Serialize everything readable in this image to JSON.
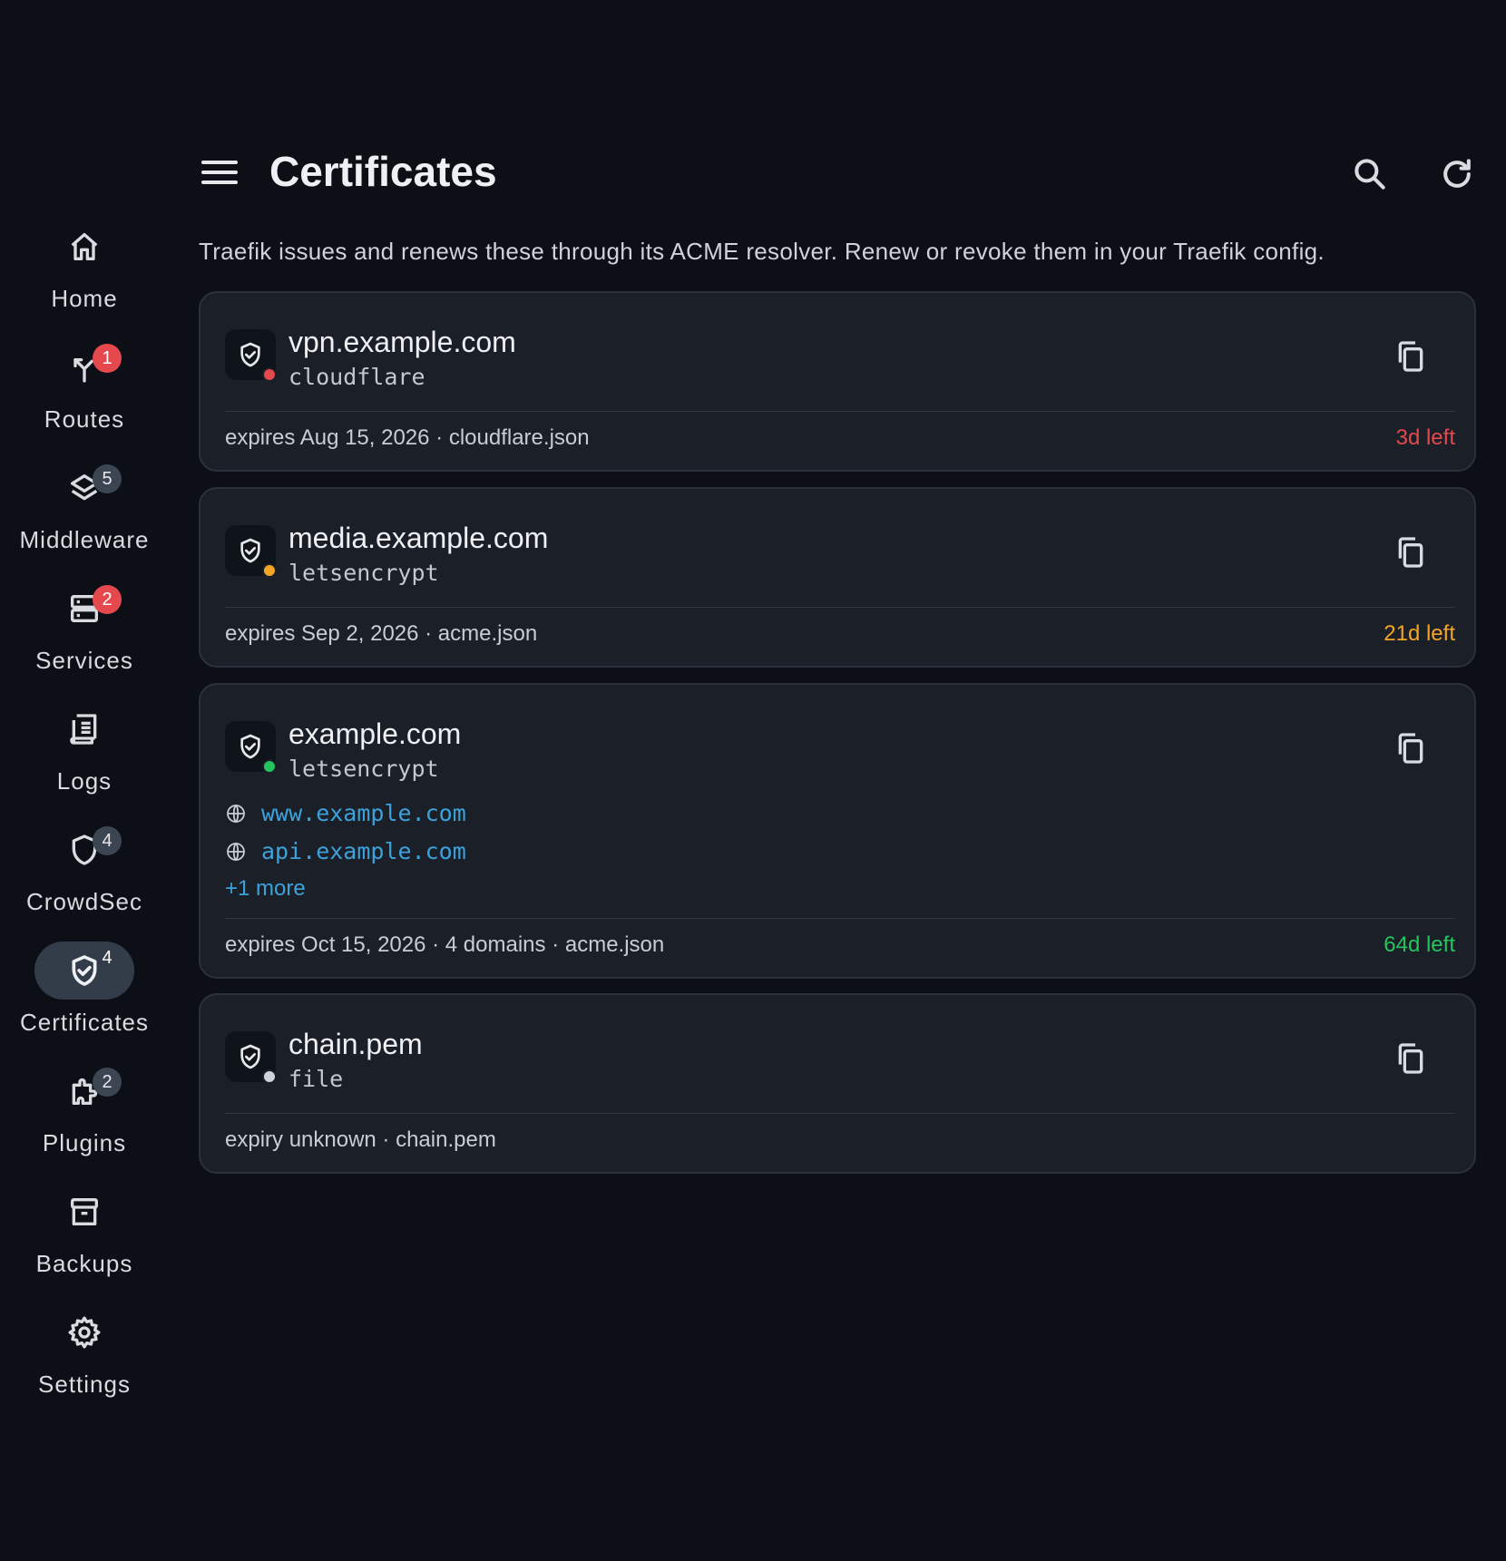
{
  "header": {
    "title": "Certificates",
    "description": "Traefik issues and renews these through its ACME resolver. Renew or revoke them in your Traefik config."
  },
  "sidebar": {
    "items": [
      {
        "label": "Home",
        "icon": "home-icon",
        "badge": ""
      },
      {
        "label": "Routes",
        "icon": "routes-icon",
        "badge": "1"
      },
      {
        "label": "Middleware",
        "icon": "layers-icon",
        "badge": "5"
      },
      {
        "label": "Services",
        "icon": "server-icon",
        "badge": "2"
      },
      {
        "label": "Logs",
        "icon": "logs-icon",
        "badge": ""
      },
      {
        "label": "CrowdSec",
        "icon": "shield-icon",
        "badge": "4"
      },
      {
        "label": "Certificates",
        "icon": "certificate-shield-icon",
        "badge": "4",
        "active": true
      },
      {
        "label": "Plugins",
        "icon": "puzzle-icon",
        "badge": "2"
      },
      {
        "label": "Backups",
        "icon": "archive-icon",
        "badge": ""
      },
      {
        "label": "Settings",
        "icon": "gear-icon",
        "badge": ""
      }
    ]
  },
  "certificates": [
    {
      "name": "vpn.example.com",
      "resolver": "cloudflare",
      "status_color": "#e5484d",
      "footer": "expires Aug 15, 2026 · cloudflare.json",
      "remaining": "3d left",
      "remaining_color": "#e5484d"
    },
    {
      "name": "media.example.com",
      "resolver": "letsencrypt",
      "status_color": "#f5a524",
      "footer": "expires Sep 2, 2026 · acme.json",
      "remaining": "21d left",
      "remaining_color": "#f5a524"
    },
    {
      "name": "example.com",
      "resolver": "letsencrypt",
      "status_color": "#22c55e",
      "sans": [
        "www.example.com",
        "api.example.com"
      ],
      "more": "+1 more",
      "footer": "expires Oct 15, 2026 · 4 domains · acme.json",
      "remaining": "64d left",
      "remaining_color": "#22c55e"
    },
    {
      "name": "chain.pem",
      "resolver": "file",
      "status_color": "#d0d4da",
      "footer": "expiry unknown · chain.pem",
      "remaining": "",
      "remaining_color": "#c9cdd3"
    }
  ]
}
